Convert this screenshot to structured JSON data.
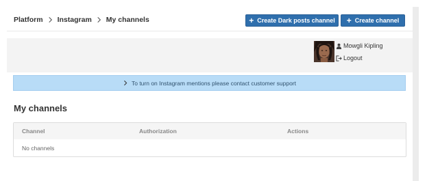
{
  "breadcrumb": {
    "items": [
      "Platform",
      "Instagram",
      "My channels"
    ]
  },
  "actions": {
    "create_dark_posts": "Create Dark posts channel",
    "create_channel": "Create channel"
  },
  "user": {
    "name": "Mowgli Kipling",
    "logout_label": "Logout"
  },
  "alert": {
    "text": "To turn on Instagram mentions please contact customer support"
  },
  "page": {
    "title": "My channels"
  },
  "table": {
    "columns": [
      "Channel",
      "Authorization",
      "Actions"
    ],
    "empty_text": "No channels"
  },
  "colors": {
    "primary_button": "#2f6fad",
    "alert_bg": "#b8dcf7",
    "userbar_bg": "#f3f3f3"
  },
  "icons": {
    "breadcrumb_separator": "chevron-right-icon",
    "button_prefix": "plus-icon",
    "user": "user-icon",
    "logout": "logout-icon",
    "alert": "chevron-right-icon"
  }
}
